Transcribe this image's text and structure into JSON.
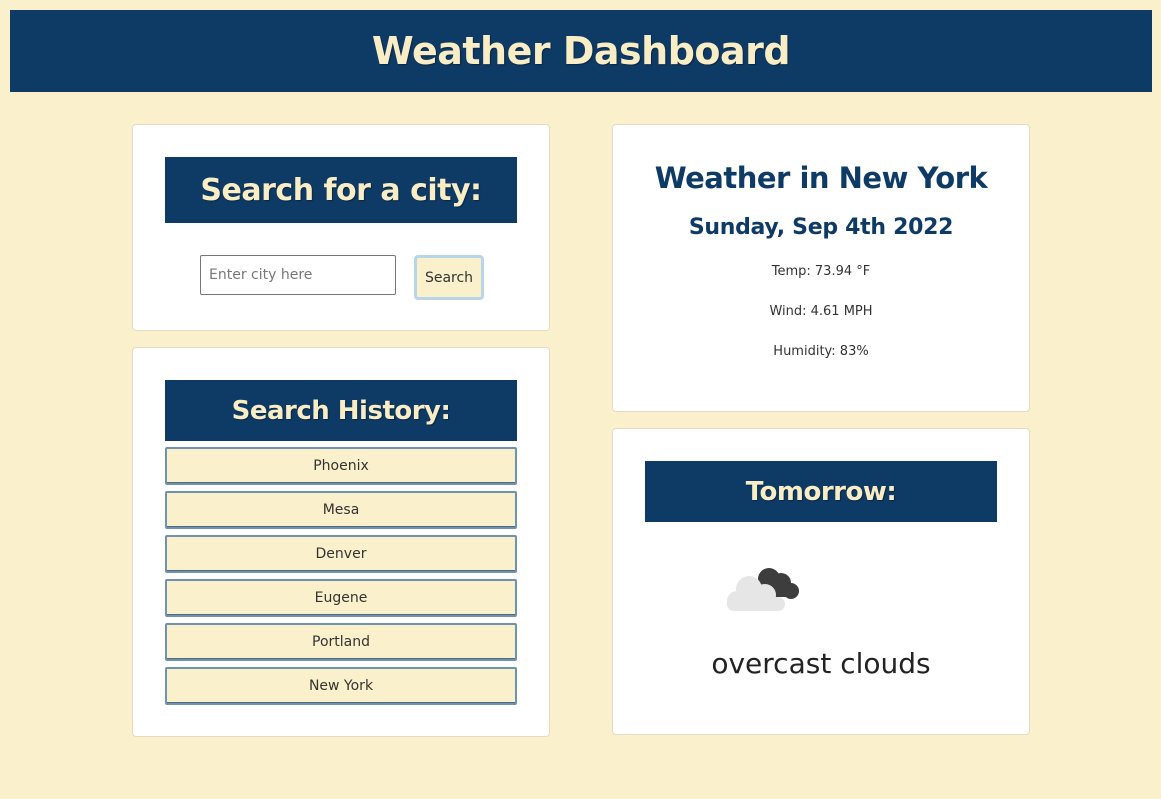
{
  "header": {
    "title": "Weather Dashboard"
  },
  "search": {
    "title": "Search for a city:",
    "placeholder": "Enter city here",
    "value": "",
    "button_label": "Search"
  },
  "history": {
    "title": "Search History:",
    "items": [
      "Phoenix",
      "Mesa",
      "Denver",
      "Eugene",
      "Portland",
      "New York"
    ]
  },
  "current": {
    "title": "Weather in New York",
    "date": "Sunday, Sep 4th 2022",
    "temp": "Temp: 73.94 °F",
    "wind": "Wind: 4.61 MPH",
    "humidity": "Humidity: 83%"
  },
  "tomorrow": {
    "title": "Tomorrow:",
    "icon": "overcast-clouds-icon",
    "description": "overcast clouds"
  },
  "colors": {
    "background": "#faf0cb",
    "accent": "#0e3a66",
    "accent_text": "#f9edc6"
  }
}
